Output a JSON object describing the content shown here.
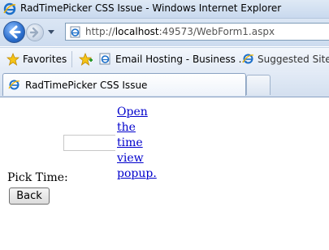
{
  "window": {
    "title": "RadTimePicker CSS Issue - Windows Internet Explorer"
  },
  "address_bar": {
    "scheme": "http://",
    "host": "localhost",
    "path": ":49573/WebForm1.aspx"
  },
  "favorites_bar": {
    "favorites_label": "Favorites",
    "items": [
      {
        "label": "Email Hosting - Business ..."
      },
      {
        "label": "Suggested Sites"
      }
    ]
  },
  "tabs": [
    {
      "label": "RadTimePicker CSS Issue"
    }
  ],
  "page": {
    "time_input_value": "",
    "popup_link_text": "Open the time view popup.",
    "pick_time_label": "Pick Time:",
    "back_button_label": "Back"
  },
  "colors": {
    "link": "#0000cc",
    "chrome_blue": "#cddcef"
  },
  "icons": [
    "ie-icon",
    "back-arrow-icon",
    "forward-arrow-icon",
    "dropdown-icon",
    "page-icon",
    "favorites-star-icon",
    "add-favorite-icon"
  ]
}
